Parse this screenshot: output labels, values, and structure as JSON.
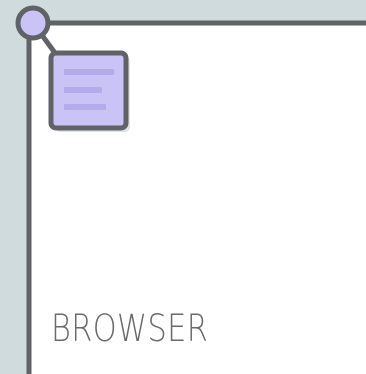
{
  "label": "BROWSER",
  "colors": {
    "background": "#cfdbdd",
    "window": "#ffffff",
    "outline": "#5f6368",
    "accent": "#c9c3f6",
    "accent_lines": "#b3acec",
    "label": "#6a6a6a"
  },
  "icons": [
    "document-icon",
    "corner-dot-icon"
  ]
}
